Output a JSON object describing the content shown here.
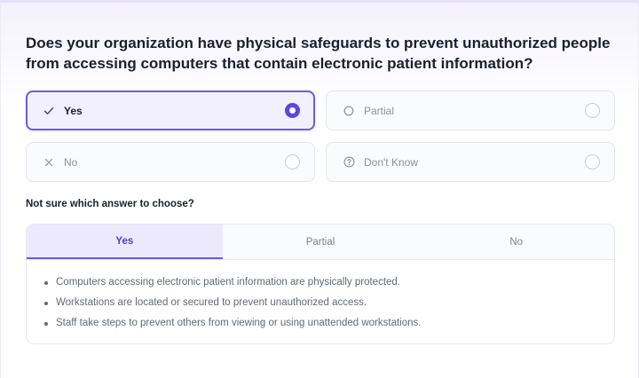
{
  "question": "Does your organization have physical safeguards to prevent unauthorized people from accessing computers that contain electronic patient information?",
  "options": [
    {
      "label": "Yes",
      "icon": "check-icon",
      "selected": true
    },
    {
      "label": "Partial",
      "icon": "circle-icon",
      "selected": false
    },
    {
      "label": "No",
      "icon": "x-icon",
      "selected": false
    },
    {
      "label": "Don't Know",
      "icon": "question-circle-icon",
      "selected": false
    }
  ],
  "guide": {
    "hint": "Not sure which answer to choose?",
    "tabs": [
      {
        "label": "Yes",
        "active": true
      },
      {
        "label": "Partial",
        "active": false
      },
      {
        "label": "No",
        "active": false
      }
    ],
    "bullets": [
      "Computers accessing electronic patient information are physically protected.",
      "Workstations are located or secured to prevent unauthorized access.",
      "Staff take steps to prevent others from viewing or using unattended workstations."
    ]
  },
  "colors": {
    "accent": "#5a48e0",
    "selected_bg": "#f2f0fe",
    "active_tab_bg": "#ede9fd"
  }
}
